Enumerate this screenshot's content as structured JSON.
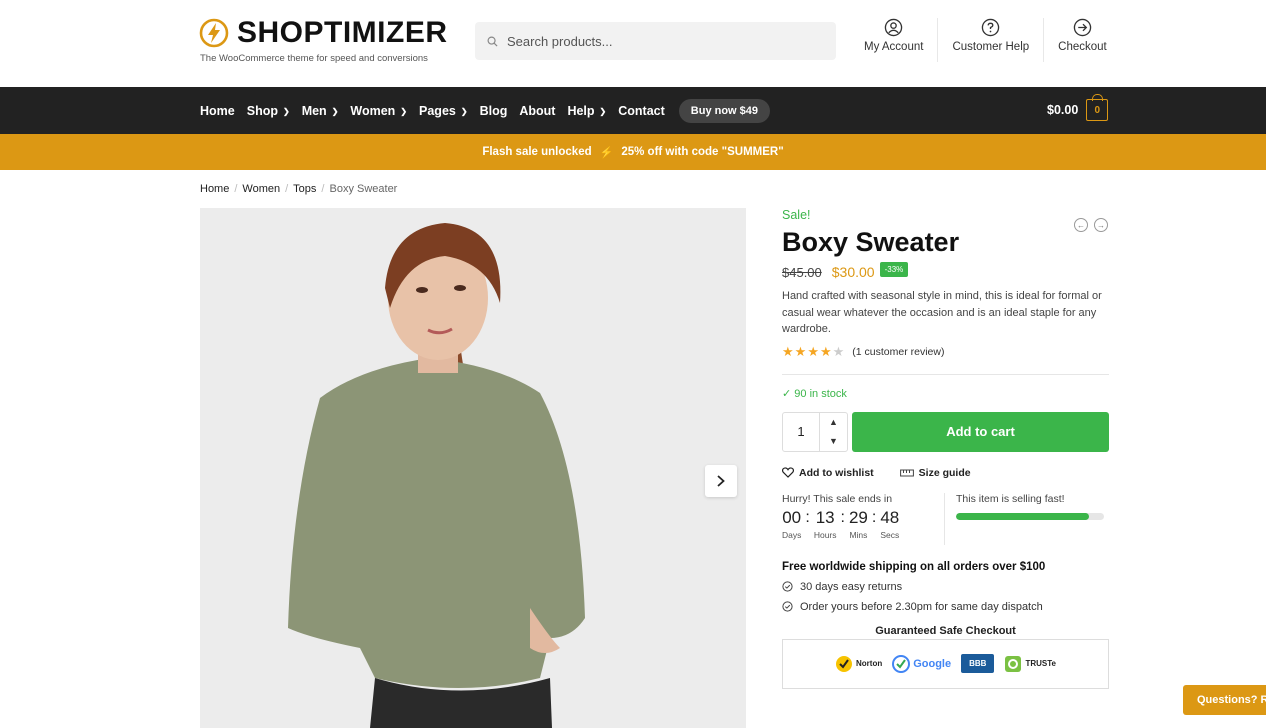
{
  "brand": {
    "name": "SHOPTIMIZER",
    "tagline": "The WooCommerce theme for speed and conversions",
    "accent": "#dc9814"
  },
  "search": {
    "placeholder": "Search products..."
  },
  "header_links": [
    {
      "label": "My Account",
      "icon": "user-icon"
    },
    {
      "label": "Customer Help",
      "icon": "help-icon"
    },
    {
      "label": "Checkout",
      "icon": "arrow-right-circle-icon"
    }
  ],
  "nav": {
    "items": [
      "Home",
      "Shop",
      "Men",
      "Women",
      "Pages",
      "Blog",
      "About",
      "Help",
      "Contact"
    ],
    "buy_now": "Buy now $49",
    "cart_total": "$0.00",
    "cart_count": "0"
  },
  "promo": {
    "left": "Flash sale unlocked",
    "right": "25% off with code \"SUMMER\""
  },
  "breadcrumb": [
    "Home",
    "Women",
    "Tops",
    "Boxy Sweater"
  ],
  "product": {
    "sale_label": "Sale!",
    "title": "Boxy Sweater",
    "old_price": "$45.00",
    "new_price": "$30.00",
    "discount": "-33%",
    "description": "Hand crafted with seasonal style in mind, this is ideal for formal or casual wear whatever the occasion and is an ideal staple for any wardrobe.",
    "rating": 4,
    "rating_max": 5,
    "reviews": "(1 customer review)",
    "stock": "90 in stock",
    "quantity": "1",
    "add_to_cart": "Add to cart",
    "wishlist": "Add to wishlist",
    "size_guide": "Size guide"
  },
  "countdown": {
    "label": "Hurry! This sale ends in",
    "days": "00",
    "hours": "13",
    "mins": "29",
    "secs": "48",
    "u_days": "Days",
    "u_hours": "Hours",
    "u_mins": "Mins",
    "u_secs": "Secs"
  },
  "selling": {
    "label": "This item is selling fast!",
    "progress": 0.9
  },
  "shipping": "Free worldwide shipping on all orders over $100",
  "features": [
    "30 days easy returns",
    "Order yours before 2.30pm for same day dispatch"
  ],
  "safe_checkout": {
    "title": "Guaranteed Safe Checkout",
    "badges": [
      "Norton",
      "Google",
      "BBB",
      "TRUSTe"
    ]
  },
  "questions": "Questions? R"
}
